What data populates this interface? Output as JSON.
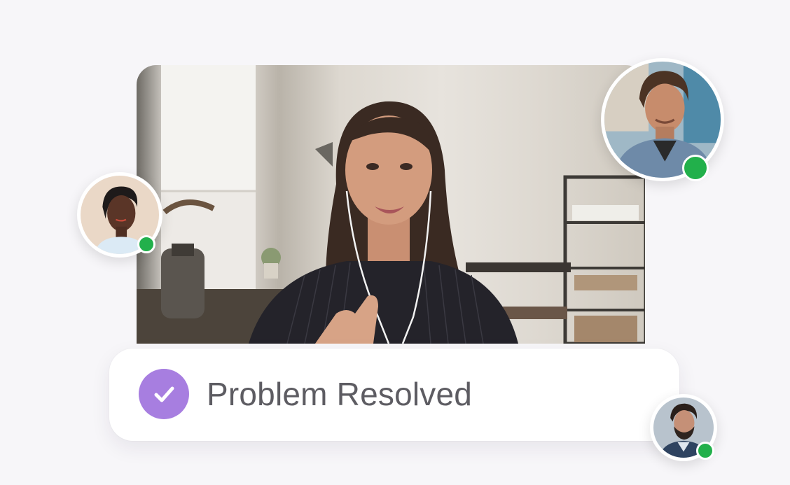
{
  "status_card": {
    "label": "Problem Resolved",
    "icon": "check-icon",
    "accent_color": "#a77ee0"
  },
  "participants": [
    {
      "role": "main-speaker",
      "status": "online"
    },
    {
      "role": "participant-left",
      "status": "online"
    },
    {
      "role": "participant-top-right",
      "status": "online"
    },
    {
      "role": "participant-bottom-right",
      "status": "online"
    }
  ],
  "colors": {
    "online": "#22b04b",
    "background": "#f7f6f9",
    "text": "#5d5c62"
  }
}
